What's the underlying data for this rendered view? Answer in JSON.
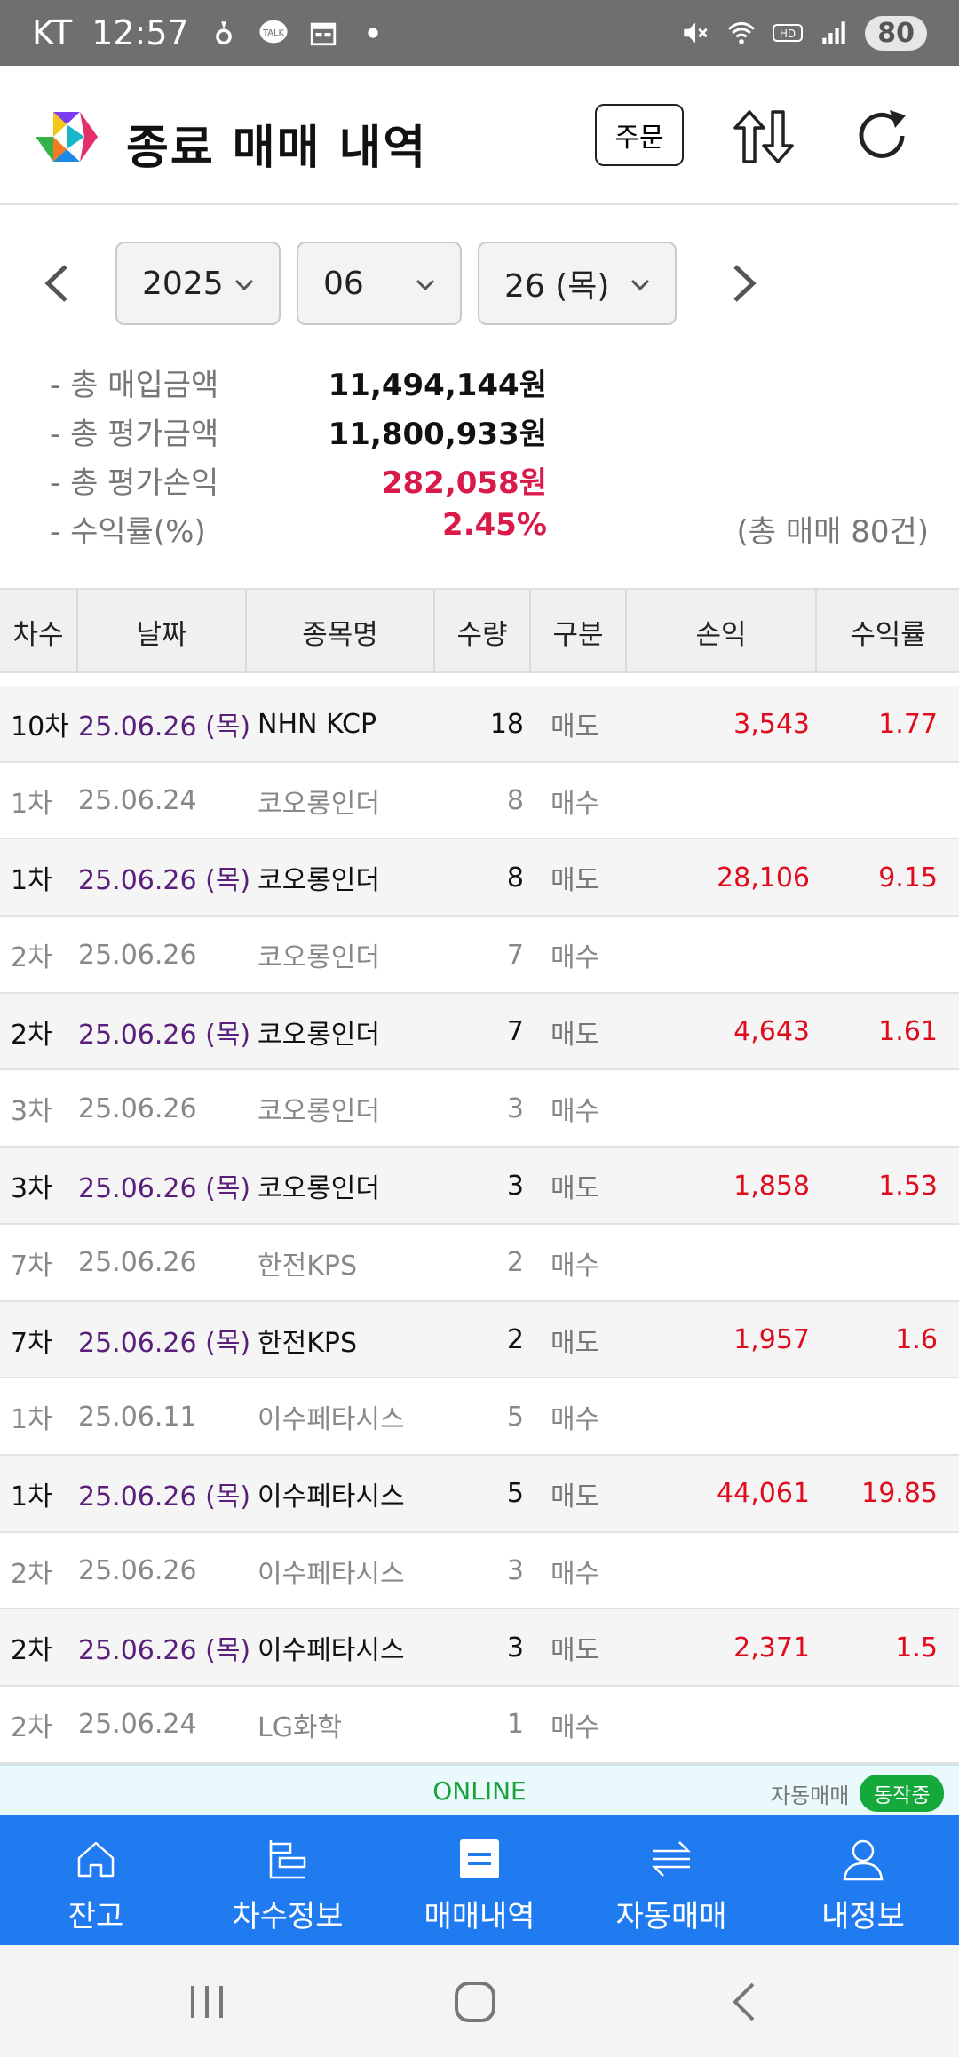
{
  "status_bar": {
    "carrier": "KT",
    "time": "12:57",
    "battery": "80"
  },
  "header": {
    "title": "종료 매매 내역",
    "order_button": "주문"
  },
  "date_filter": {
    "year": "2025",
    "month": "06",
    "day": "26 (목)"
  },
  "summary": {
    "items": [
      {
        "label": "- 총 매입금액",
        "value": "11,494,144원"
      },
      {
        "label": "- 총 평가금액",
        "value": "11,800,933원"
      },
      {
        "label": "- 총 평가손익",
        "value": "282,058원"
      },
      {
        "label": "- 수익률(%)",
        "value": "2.45%"
      }
    ],
    "total_count": "(총 매매 80건)"
  },
  "table": {
    "columns": [
      "차수",
      "날짜",
      "종목명",
      "수량",
      "구분",
      "손익",
      "수익률"
    ],
    "rows": [
      {
        "kind": "sell",
        "round": "10차",
        "date": "25.06.26 (목)",
        "name": "NHN KCP",
        "qty": "18",
        "type": "매도",
        "pl": "3,543",
        "rate": "1.77"
      },
      {
        "kind": "buy",
        "round": "1차",
        "date": "25.06.24",
        "name": "코오롱인더",
        "qty": "8",
        "type": "매수",
        "pl": "",
        "rate": ""
      },
      {
        "kind": "sell",
        "round": "1차",
        "date": "25.06.26 (목)",
        "name": "코오롱인더",
        "qty": "8",
        "type": "매도",
        "pl": "28,106",
        "rate": "9.15"
      },
      {
        "kind": "buy",
        "round": "2차",
        "date": "25.06.26",
        "name": "코오롱인더",
        "qty": "7",
        "type": "매수",
        "pl": "",
        "rate": ""
      },
      {
        "kind": "sell",
        "round": "2차",
        "date": "25.06.26 (목)",
        "name": "코오롱인더",
        "qty": "7",
        "type": "매도",
        "pl": "4,643",
        "rate": "1.61"
      },
      {
        "kind": "buy",
        "round": "3차",
        "date": "25.06.26",
        "name": "코오롱인더",
        "qty": "3",
        "type": "매수",
        "pl": "",
        "rate": ""
      },
      {
        "kind": "sell",
        "round": "3차",
        "date": "25.06.26 (목)",
        "name": "코오롱인더",
        "qty": "3",
        "type": "매도",
        "pl": "1,858",
        "rate": "1.53"
      },
      {
        "kind": "buy",
        "round": "7차",
        "date": "25.06.26",
        "name": "한전KPS",
        "qty": "2",
        "type": "매수",
        "pl": "",
        "rate": ""
      },
      {
        "kind": "sell",
        "round": "7차",
        "date": "25.06.26 (목)",
        "name": "한전KPS",
        "qty": "2",
        "type": "매도",
        "pl": "1,957",
        "rate": "1.6"
      },
      {
        "kind": "buy",
        "round": "1차",
        "date": "25.06.11",
        "name": "이수페타시스",
        "qty": "5",
        "type": "매수",
        "pl": "",
        "rate": ""
      },
      {
        "kind": "sell",
        "round": "1차",
        "date": "25.06.26 (목)",
        "name": "이수페타시스",
        "qty": "5",
        "type": "매도",
        "pl": "44,061",
        "rate": "19.85"
      },
      {
        "kind": "buy",
        "round": "2차",
        "date": "25.06.26",
        "name": "이수페타시스",
        "qty": "3",
        "type": "매수",
        "pl": "",
        "rate": ""
      },
      {
        "kind": "sell",
        "round": "2차",
        "date": "25.06.26 (목)",
        "name": "이수페타시스",
        "qty": "3",
        "type": "매도",
        "pl": "2,371",
        "rate": "1.5"
      },
      {
        "kind": "buy",
        "round": "2차",
        "date": "25.06.24",
        "name": "LG화학",
        "qty": "1",
        "type": "매수",
        "pl": "",
        "rate": ""
      }
    ]
  },
  "online_bar": {
    "status": "ONLINE",
    "auto_trade_label": "자동매매",
    "auto_trade_badge": "동작중"
  },
  "bottom_nav": {
    "items": [
      {
        "label": "잔고",
        "icon": "home-icon"
      },
      {
        "label": "차수정보",
        "icon": "layers-icon"
      },
      {
        "label": "매매내역",
        "icon": "list-icon"
      },
      {
        "label": "자동매매",
        "icon": "swap-icon"
      },
      {
        "label": "내정보",
        "icon": "user-icon"
      }
    ]
  },
  "colors": {
    "accent": "#1f7bef",
    "loss_profit": "#e00b1c",
    "online": "#1aa33a"
  }
}
